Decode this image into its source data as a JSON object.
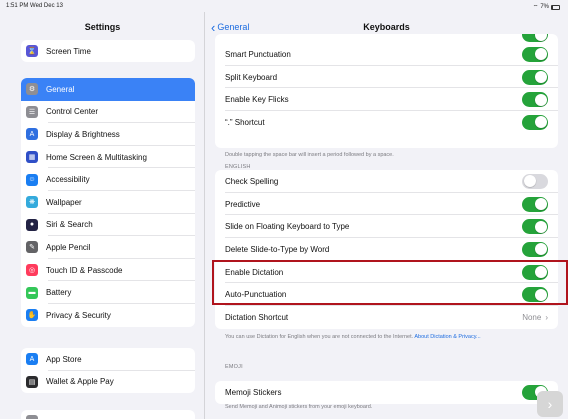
{
  "status": {
    "time": "1:51 PM  Wed Dec 13",
    "battery": "7%"
  },
  "sidebar": {
    "title": "Settings",
    "group1": [
      {
        "label": "Screen Time",
        "icon": "hourglass-icon",
        "color": "#5856d6",
        "glyph": "⌛"
      }
    ],
    "group2": [
      {
        "label": "General",
        "icon": "gear-icon",
        "color": "#8e8e93",
        "glyph": "⚙",
        "selected": true
      },
      {
        "label": "Control Center",
        "icon": "sliders-icon",
        "color": "#8e8e93",
        "glyph": "☰"
      },
      {
        "label": "Display & Brightness",
        "icon": "display-icon",
        "color": "#2f6fe0",
        "glyph": "A"
      },
      {
        "label": "Home Screen & Multitasking",
        "icon": "grid-icon",
        "color": "#2f4fc7",
        "glyph": "▦"
      },
      {
        "label": "Accessibility",
        "icon": "accessibility-icon",
        "color": "#1a7ef2",
        "glyph": "☺"
      },
      {
        "label": "Wallpaper",
        "icon": "wallpaper-icon",
        "color": "#34aadc",
        "glyph": "❋"
      },
      {
        "label": "Siri & Search",
        "icon": "siri-icon",
        "color": "#222244",
        "glyph": "●"
      },
      {
        "label": "Apple Pencil",
        "icon": "pencil-icon",
        "color": "#636366",
        "glyph": "✎"
      },
      {
        "label": "Touch ID & Passcode",
        "icon": "fingerprint-icon",
        "color": "#ff3b5c",
        "glyph": "◎"
      },
      {
        "label": "Battery",
        "icon": "battery-icon",
        "color": "#34c759",
        "glyph": "▬"
      },
      {
        "label": "Privacy & Security",
        "icon": "hand-icon",
        "color": "#1a7ef2",
        "glyph": "✋"
      }
    ],
    "group3": [
      {
        "label": "App Store",
        "icon": "app-store-icon",
        "color": "#1a7ef2",
        "glyph": "A"
      },
      {
        "label": "Wallet & Apple Pay",
        "icon": "wallet-icon",
        "color": "#2c2c2e",
        "glyph": "▤"
      }
    ]
  },
  "main": {
    "back_label": "General",
    "title": "Keyboards",
    "section1_rows": [
      {
        "label": "Smart Punctuation",
        "toggle": "on"
      },
      {
        "label": "Split Keyboard",
        "toggle": "on"
      },
      {
        "label": "Enable Key Flicks",
        "toggle": "on"
      },
      {
        "label": "“.” Shortcut",
        "toggle": "on"
      }
    ],
    "section1_footer": "Double tapping the space bar will insert a period followed by a space.",
    "english_header": "ENGLISH",
    "english_rows": [
      {
        "label": "Check Spelling",
        "toggle": "off"
      },
      {
        "label": "Predictive",
        "toggle": "on"
      },
      {
        "label": "Slide on Floating Keyboard to Type",
        "toggle": "on"
      },
      {
        "label": "Delete Slide-to-Type by Word",
        "toggle": "on"
      },
      {
        "label": "Enable Dictation",
        "toggle": "on"
      },
      {
        "label": "Auto-Punctuation",
        "toggle": "on"
      }
    ],
    "dictation_shortcut": {
      "label": "Dictation Shortcut",
      "value": "None"
    },
    "english_footer": "You can use Dictation for English when you are not connected to the Internet.",
    "english_footer_link": "About Dictation & Privacy...",
    "emoji_header": "EMOJI",
    "emoji_rows": [
      {
        "label": "Memoji Stickers",
        "toggle": "on"
      }
    ],
    "emoji_footer": "Send Memoji and Animoji stickers from your emoji keyboard."
  },
  "colors": {
    "accent": "#1e6de0",
    "toggle_on": "#25a33a",
    "highlight": "#b0141d",
    "selected": "#3a82f6"
  }
}
